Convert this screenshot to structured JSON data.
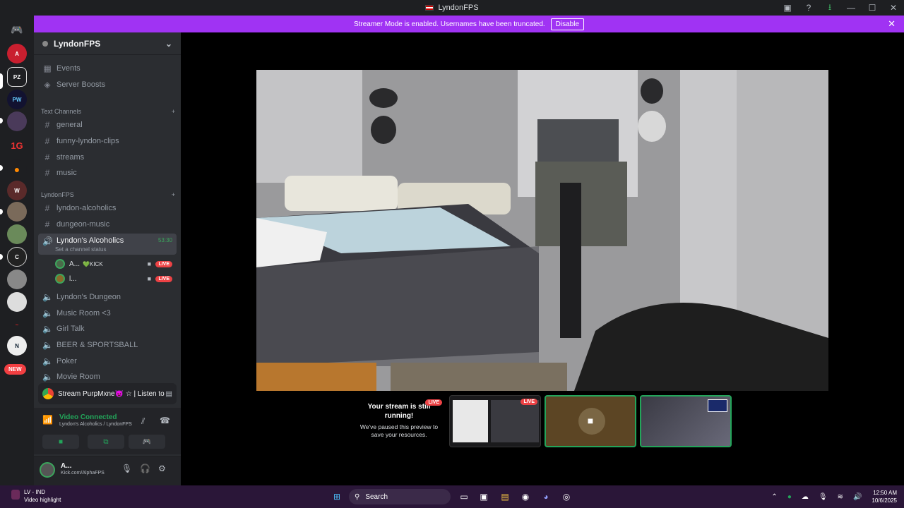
{
  "app": {
    "window_title": "LyndonFPS"
  },
  "banner": {
    "text": "Streamer Mode is enabled. Usernames have been truncated.",
    "button": "Disable"
  },
  "rail": {
    "new_badge": "NEW"
  },
  "guild": {
    "name": "LyndonFPS",
    "top_items": [
      "Events",
      "Server Boosts"
    ],
    "categories": [
      "Text Channels",
      "LyndonFPS"
    ],
    "text_channels": [
      "general",
      "funny-lyndon-clips",
      "streams",
      "music"
    ],
    "lyndon_channels": [
      "lyndon-alcoholics",
      "dungeon-music"
    ],
    "active_voice": {
      "name": "Lyndon's Alcoholics",
      "status": "Set a channel status",
      "time": "53:30"
    },
    "voice_users": [
      {
        "name": "A...",
        "tag": "💚KICK",
        "live": "LIVE"
      },
      {
        "name": "l...",
        "tag": "",
        "live": "LIVE"
      }
    ],
    "voice_channels": [
      "Lyndon's Dungeon",
      "Music Room <3",
      "Girl Talk",
      "BEER & SPORTSBALL",
      "Poker",
      "Movie Room"
    ]
  },
  "activity": {
    "text": "Stream PurpMxne👿 ☆ | Listen to ..."
  },
  "rtc": {
    "status": "Video Connected",
    "location": "Lyndon's Alcoholics / LyndonFPS"
  },
  "user": {
    "name": "A...",
    "status": "Kick.com/AlphaFPS"
  },
  "stream": {
    "paused_title": "Your stream is still running!",
    "paused_body": "We've paused this preview to save your resources.",
    "live": "LIVE"
  },
  "taskbar": {
    "weather_line1": "LV - IND",
    "weather_line2": "Video highlight",
    "search": "Search",
    "time": "12:50 AM",
    "date": "10/6/2025"
  }
}
